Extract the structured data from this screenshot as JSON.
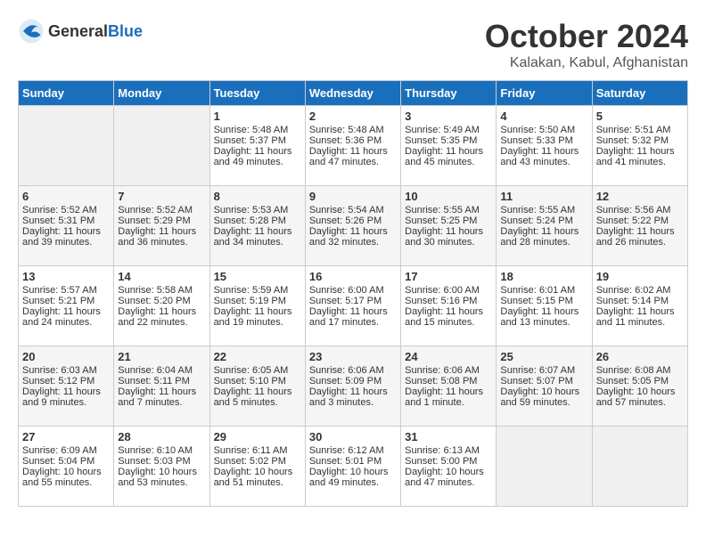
{
  "header": {
    "logo_general": "General",
    "logo_blue": "Blue",
    "month": "October 2024",
    "location": "Kalakan, Kabul, Afghanistan"
  },
  "days_of_week": [
    "Sunday",
    "Monday",
    "Tuesday",
    "Wednesday",
    "Thursday",
    "Friday",
    "Saturday"
  ],
  "weeks": [
    [
      {
        "day": "",
        "sunrise": "",
        "sunset": "",
        "daylight": ""
      },
      {
        "day": "",
        "sunrise": "",
        "sunset": "",
        "daylight": ""
      },
      {
        "day": "1",
        "sunrise": "Sunrise: 5:48 AM",
        "sunset": "Sunset: 5:37 PM",
        "daylight": "Daylight: 11 hours and 49 minutes."
      },
      {
        "day": "2",
        "sunrise": "Sunrise: 5:48 AM",
        "sunset": "Sunset: 5:36 PM",
        "daylight": "Daylight: 11 hours and 47 minutes."
      },
      {
        "day": "3",
        "sunrise": "Sunrise: 5:49 AM",
        "sunset": "Sunset: 5:35 PM",
        "daylight": "Daylight: 11 hours and 45 minutes."
      },
      {
        "day": "4",
        "sunrise": "Sunrise: 5:50 AM",
        "sunset": "Sunset: 5:33 PM",
        "daylight": "Daylight: 11 hours and 43 minutes."
      },
      {
        "day": "5",
        "sunrise": "Sunrise: 5:51 AM",
        "sunset": "Sunset: 5:32 PM",
        "daylight": "Daylight: 11 hours and 41 minutes."
      }
    ],
    [
      {
        "day": "6",
        "sunrise": "Sunrise: 5:52 AM",
        "sunset": "Sunset: 5:31 PM",
        "daylight": "Daylight: 11 hours and 39 minutes."
      },
      {
        "day": "7",
        "sunrise": "Sunrise: 5:52 AM",
        "sunset": "Sunset: 5:29 PM",
        "daylight": "Daylight: 11 hours and 36 minutes."
      },
      {
        "day": "8",
        "sunrise": "Sunrise: 5:53 AM",
        "sunset": "Sunset: 5:28 PM",
        "daylight": "Daylight: 11 hours and 34 minutes."
      },
      {
        "day": "9",
        "sunrise": "Sunrise: 5:54 AM",
        "sunset": "Sunset: 5:26 PM",
        "daylight": "Daylight: 11 hours and 32 minutes."
      },
      {
        "day": "10",
        "sunrise": "Sunrise: 5:55 AM",
        "sunset": "Sunset: 5:25 PM",
        "daylight": "Daylight: 11 hours and 30 minutes."
      },
      {
        "day": "11",
        "sunrise": "Sunrise: 5:55 AM",
        "sunset": "Sunset: 5:24 PM",
        "daylight": "Daylight: 11 hours and 28 minutes."
      },
      {
        "day": "12",
        "sunrise": "Sunrise: 5:56 AM",
        "sunset": "Sunset: 5:22 PM",
        "daylight": "Daylight: 11 hours and 26 minutes."
      }
    ],
    [
      {
        "day": "13",
        "sunrise": "Sunrise: 5:57 AM",
        "sunset": "Sunset: 5:21 PM",
        "daylight": "Daylight: 11 hours and 24 minutes."
      },
      {
        "day": "14",
        "sunrise": "Sunrise: 5:58 AM",
        "sunset": "Sunset: 5:20 PM",
        "daylight": "Daylight: 11 hours and 22 minutes."
      },
      {
        "day": "15",
        "sunrise": "Sunrise: 5:59 AM",
        "sunset": "Sunset: 5:19 PM",
        "daylight": "Daylight: 11 hours and 19 minutes."
      },
      {
        "day": "16",
        "sunrise": "Sunrise: 6:00 AM",
        "sunset": "Sunset: 5:17 PM",
        "daylight": "Daylight: 11 hours and 17 minutes."
      },
      {
        "day": "17",
        "sunrise": "Sunrise: 6:00 AM",
        "sunset": "Sunset: 5:16 PM",
        "daylight": "Daylight: 11 hours and 15 minutes."
      },
      {
        "day": "18",
        "sunrise": "Sunrise: 6:01 AM",
        "sunset": "Sunset: 5:15 PM",
        "daylight": "Daylight: 11 hours and 13 minutes."
      },
      {
        "day": "19",
        "sunrise": "Sunrise: 6:02 AM",
        "sunset": "Sunset: 5:14 PM",
        "daylight": "Daylight: 11 hours and 11 minutes."
      }
    ],
    [
      {
        "day": "20",
        "sunrise": "Sunrise: 6:03 AM",
        "sunset": "Sunset: 5:12 PM",
        "daylight": "Daylight: 11 hours and 9 minutes."
      },
      {
        "day": "21",
        "sunrise": "Sunrise: 6:04 AM",
        "sunset": "Sunset: 5:11 PM",
        "daylight": "Daylight: 11 hours and 7 minutes."
      },
      {
        "day": "22",
        "sunrise": "Sunrise: 6:05 AM",
        "sunset": "Sunset: 5:10 PM",
        "daylight": "Daylight: 11 hours and 5 minutes."
      },
      {
        "day": "23",
        "sunrise": "Sunrise: 6:06 AM",
        "sunset": "Sunset: 5:09 PM",
        "daylight": "Daylight: 11 hours and 3 minutes."
      },
      {
        "day": "24",
        "sunrise": "Sunrise: 6:06 AM",
        "sunset": "Sunset: 5:08 PM",
        "daylight": "Daylight: 11 hours and 1 minute."
      },
      {
        "day": "25",
        "sunrise": "Sunrise: 6:07 AM",
        "sunset": "Sunset: 5:07 PM",
        "daylight": "Daylight: 10 hours and 59 minutes."
      },
      {
        "day": "26",
        "sunrise": "Sunrise: 6:08 AM",
        "sunset": "Sunset: 5:05 PM",
        "daylight": "Daylight: 10 hours and 57 minutes."
      }
    ],
    [
      {
        "day": "27",
        "sunrise": "Sunrise: 6:09 AM",
        "sunset": "Sunset: 5:04 PM",
        "daylight": "Daylight: 10 hours and 55 minutes."
      },
      {
        "day": "28",
        "sunrise": "Sunrise: 6:10 AM",
        "sunset": "Sunset: 5:03 PM",
        "daylight": "Daylight: 10 hours and 53 minutes."
      },
      {
        "day": "29",
        "sunrise": "Sunrise: 6:11 AM",
        "sunset": "Sunset: 5:02 PM",
        "daylight": "Daylight: 10 hours and 51 minutes."
      },
      {
        "day": "30",
        "sunrise": "Sunrise: 6:12 AM",
        "sunset": "Sunset: 5:01 PM",
        "daylight": "Daylight: 10 hours and 49 minutes."
      },
      {
        "day": "31",
        "sunrise": "Sunrise: 6:13 AM",
        "sunset": "Sunset: 5:00 PM",
        "daylight": "Daylight: 10 hours and 47 minutes."
      },
      {
        "day": "",
        "sunrise": "",
        "sunset": "",
        "daylight": ""
      },
      {
        "day": "",
        "sunrise": "",
        "sunset": "",
        "daylight": ""
      }
    ]
  ]
}
